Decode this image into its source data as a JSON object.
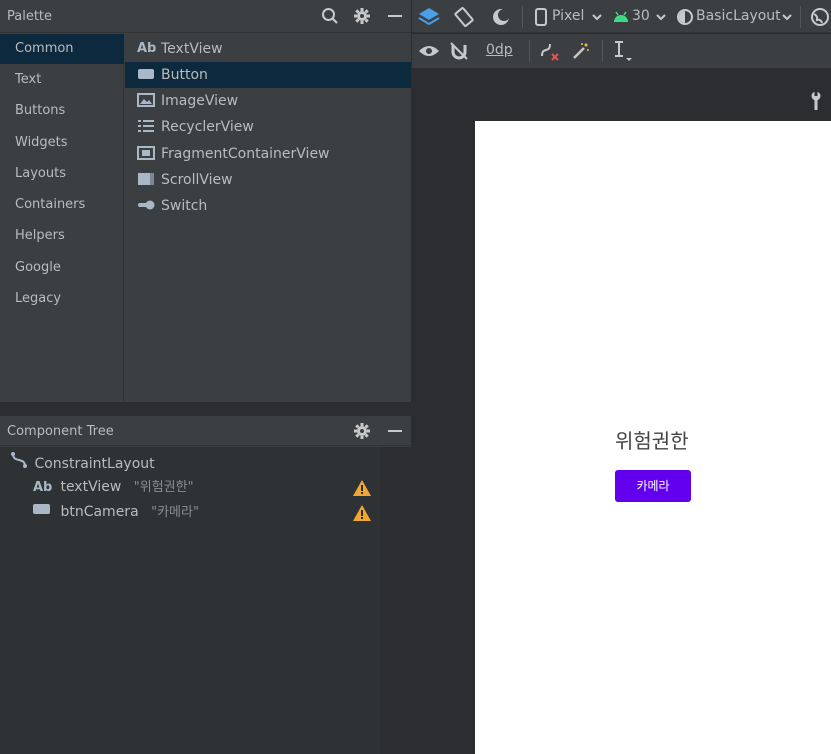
{
  "palette": {
    "title": "Palette",
    "categories": [
      "Common",
      "Text",
      "Buttons",
      "Widgets",
      "Layouts",
      "Containers",
      "Helpers",
      "Google",
      "Legacy"
    ],
    "selected_category": "Common",
    "widgets": [
      {
        "label": "TextView",
        "icon": "ab-text-icon",
        "icon_text": "Ab"
      },
      {
        "label": "Button",
        "icon": "button-icon"
      },
      {
        "label": "ImageView",
        "icon": "image-icon"
      },
      {
        "label": "RecyclerView",
        "icon": "list-icon"
      },
      {
        "label": "FragmentContainerView",
        "icon": "fragment-icon"
      },
      {
        "label": "ScrollView",
        "icon": "scroll-icon"
      },
      {
        "label": "Switch",
        "icon": "switch-icon"
      }
    ],
    "selected_widget": "Button"
  },
  "component_tree": {
    "title": "Component Tree",
    "root": "ConstraintLayout",
    "children": [
      {
        "name": "textView",
        "value": "\"위험권한\"",
        "icon_text": "Ab"
      },
      {
        "name": "btnCamera",
        "value": "\"카메라\""
      }
    ]
  },
  "toolbar": {
    "device": "Pixel",
    "api": "30",
    "theme": "BasicLayout",
    "margin": "0dp"
  },
  "preview": {
    "text": "위험권한",
    "button_label": "카메라"
  },
  "colors": {
    "selection": "#0d293e",
    "button": "#6200ee",
    "warning": "#f0a732",
    "android_green": "#3ddc84"
  }
}
